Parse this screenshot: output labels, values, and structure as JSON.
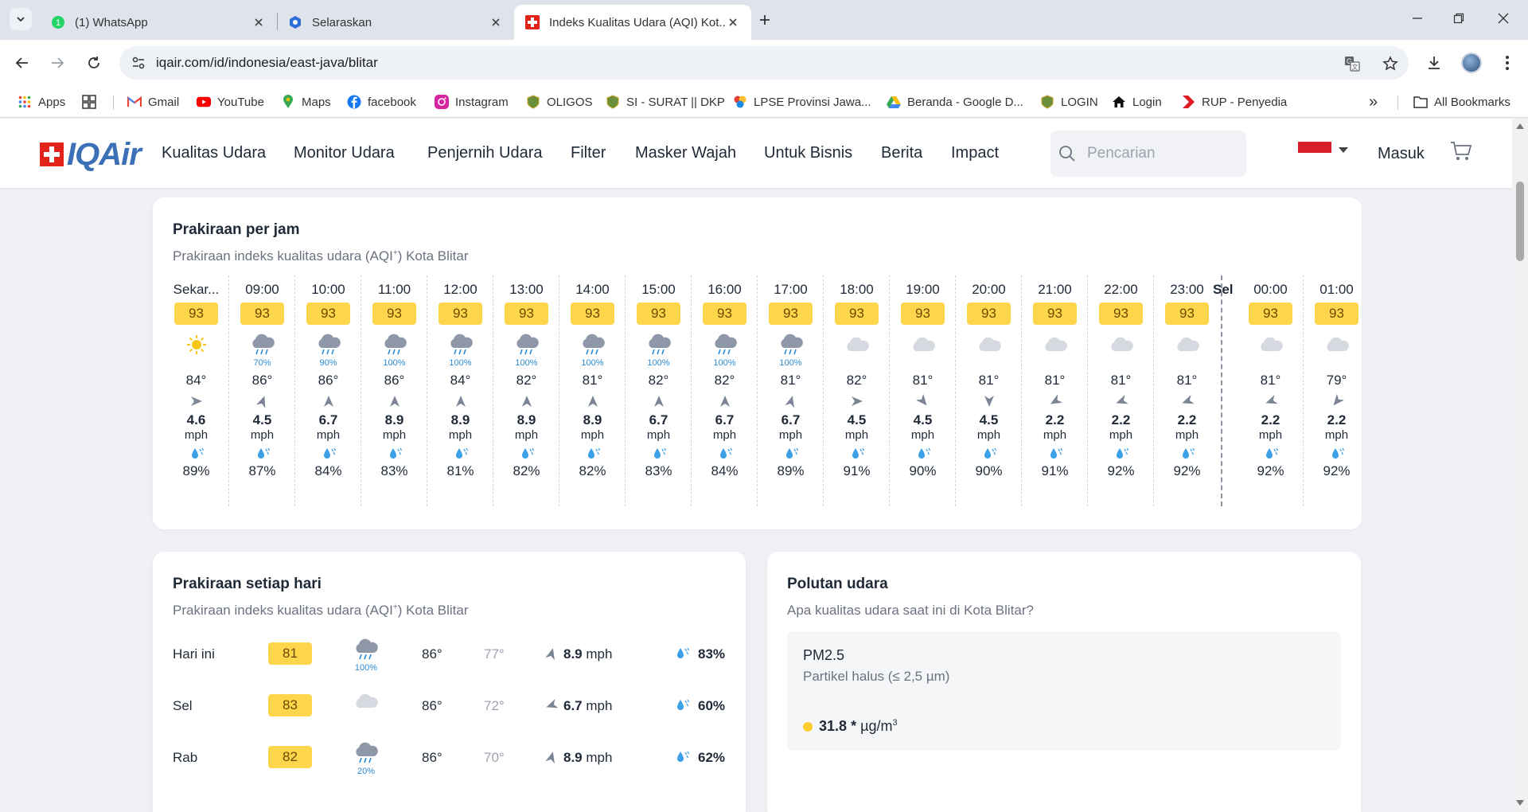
{
  "browser": {
    "tabs": [
      {
        "title": "(1) WhatsApp"
      },
      {
        "title": "Selaraskan"
      },
      {
        "title": "Indeks Kualitas Udara (AQI) Kot..."
      }
    ],
    "url": "iqair.com/id/indonesia/east-java/blitar",
    "bookmarks": [
      "Apps",
      "Gmail",
      "YouTube",
      "Maps",
      "facebook",
      "Instagram",
      "OLIGOS",
      "SI - SURAT || DKP",
      "LPSE Provinsi Jawa...",
      "Beranda - Google D...",
      "LOGIN",
      "Login",
      "RUP - Penyedia"
    ],
    "all_bookmarks": "All Bookmarks",
    "more": "»"
  },
  "site": {
    "logo": "IQAir",
    "nav": [
      "Kualitas Udara",
      "Monitor Udara",
      "Penjernih Udara",
      "Filter",
      "Masker Wajah",
      "Untuk Bisnis",
      "Berita",
      "Impact"
    ],
    "search_placeholder": "Pencarian",
    "login": "Masuk",
    "colors": {
      "aqi_moderate": "#fdd64b",
      "brand_red": "#e2231a",
      "brand_blue": "#3b6fb6",
      "rain_blue": "#2b8bd4"
    }
  },
  "hourly": {
    "title": "Prakiraan per jam",
    "subtitle_pre": "Prakiraan indeks kualitas udara (AQI",
    "subtitle_sup": "+",
    "subtitle_post": ") Kota Blitar",
    "wind_unit": "mph",
    "day_label": "Sel",
    "hours": [
      {
        "time": "Sekar...",
        "aqi": "93",
        "icon": "sun",
        "rain": "",
        "temp": "84°",
        "wind": "4.6",
        "dir": 90,
        "hum": "89%"
      },
      {
        "time": "09:00",
        "aqi": "93",
        "icon": "rain",
        "rain": "70%",
        "temp": "86°",
        "wind": "4.5",
        "dir": 20,
        "hum": "87%"
      },
      {
        "time": "10:00",
        "aqi": "93",
        "icon": "rain",
        "rain": "90%",
        "temp": "86°",
        "wind": "6.7",
        "dir": 0,
        "hum": "84%"
      },
      {
        "time": "11:00",
        "aqi": "93",
        "icon": "rain",
        "rain": "100%",
        "temp": "86°",
        "wind": "8.9",
        "dir": 0,
        "hum": "83%"
      },
      {
        "time": "12:00",
        "aqi": "93",
        "icon": "rain",
        "rain": "100%",
        "temp": "84°",
        "wind": "8.9",
        "dir": 0,
        "hum": "81%"
      },
      {
        "time": "13:00",
        "aqi": "93",
        "icon": "rain",
        "rain": "100%",
        "temp": "82°",
        "wind": "8.9",
        "dir": 0,
        "hum": "82%"
      },
      {
        "time": "14:00",
        "aqi": "93",
        "icon": "rain",
        "rain": "100%",
        "temp": "81°",
        "wind": "8.9",
        "dir": 0,
        "hum": "82%"
      },
      {
        "time": "15:00",
        "aqi": "93",
        "icon": "rain",
        "rain": "100%",
        "temp": "82°",
        "wind": "6.7",
        "dir": 0,
        "hum": "83%"
      },
      {
        "time": "16:00",
        "aqi": "93",
        "icon": "rain",
        "rain": "100%",
        "temp": "82°",
        "wind": "6.7",
        "dir": 0,
        "hum": "84%"
      },
      {
        "time": "17:00",
        "aqi": "93",
        "icon": "rain",
        "rain": "100%",
        "temp": "81°",
        "wind": "6.7",
        "dir": 15,
        "hum": "89%"
      },
      {
        "time": "18:00",
        "aqi": "93",
        "icon": "cloud",
        "rain": "",
        "temp": "82°",
        "wind": "4.5",
        "dir": 90,
        "hum": "91%"
      },
      {
        "time": "19:00",
        "aqi": "93",
        "icon": "cloud",
        "rain": "",
        "temp": "81°",
        "wind": "4.5",
        "dir": 140,
        "hum": "90%"
      },
      {
        "time": "20:00",
        "aqi": "93",
        "icon": "cloud",
        "rain": "",
        "temp": "81°",
        "wind": "4.5",
        "dir": 180,
        "hum": "90%"
      },
      {
        "time": "21:00",
        "aqi": "93",
        "icon": "cloud",
        "rain": "",
        "temp": "81°",
        "wind": "2.2",
        "dir": 240,
        "hum": "91%"
      },
      {
        "time": "22:00",
        "aqi": "93",
        "icon": "cloud",
        "rain": "",
        "temp": "81°",
        "wind": "2.2",
        "dir": 250,
        "hum": "92%"
      },
      {
        "time": "23:00",
        "aqi": "93",
        "icon": "cloud",
        "rain": "",
        "temp": "81°",
        "wind": "2.2",
        "dir": 250,
        "hum": "92%"
      },
      {
        "time": "00:00",
        "aqi": "93",
        "icon": "cloud",
        "rain": "",
        "temp": "81°",
        "wind": "2.2",
        "dir": 250,
        "hum": "92%"
      },
      {
        "time": "01:00",
        "aqi": "93",
        "icon": "cloud",
        "rain": "",
        "temp": "79°",
        "wind": "2.2",
        "dir": 220,
        "hum": "92%"
      }
    ]
  },
  "daily": {
    "title": "Prakiraan setiap hari",
    "subtitle_pre": "Prakiraan indeks kualitas udara (AQI",
    "subtitle_sup": "+",
    "subtitle_post": ") Kota Blitar",
    "days": [
      {
        "day": "Hari ini",
        "aqi": "81",
        "icon": "rain",
        "rain": "100%",
        "hi": "86°",
        "lo": "77°",
        "wind": "8.9",
        "unit": "mph",
        "dir": 15,
        "hum": "83%"
      },
      {
        "day": "Sel",
        "aqi": "83",
        "icon": "cloud",
        "rain": "",
        "hi": "86°",
        "lo": "72°",
        "wind": "6.7",
        "unit": "mph",
        "dir": 250,
        "hum": "60%"
      },
      {
        "day": "Rab",
        "aqi": "82",
        "icon": "rain",
        "rain": "20%",
        "hi": "86°",
        "lo": "70°",
        "wind": "8.9",
        "unit": "mph",
        "dir": 15,
        "hum": "62%"
      }
    ]
  },
  "pollutants": {
    "title": "Polutan udara",
    "subtitle": "Apa kualitas udara saat ini di Kota Blitar?",
    "items": [
      {
        "name": "PM2.5",
        "desc": "Partikel halus (≤ 2,5 µm)",
        "value": "31.8",
        "star": "*",
        "unit": "µg/m",
        "unit_sup": "3"
      }
    ]
  }
}
